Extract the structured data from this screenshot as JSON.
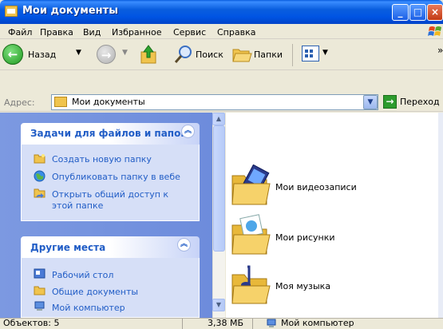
{
  "window": {
    "title": "Мои документы"
  },
  "menu": [
    "Файл",
    "Правка",
    "Вид",
    "Избранное",
    "Сервис",
    "Справка"
  ],
  "toolbar": {
    "back_label": "Назад",
    "search_label": "Поиск",
    "folders_label": "Папки"
  },
  "address": {
    "label": "Адрес:",
    "value": "Мои документы",
    "go_label": "Переход"
  },
  "tasks_panel": {
    "title": "Задачи для файлов и папок",
    "items": [
      {
        "label": "Создать новую папку",
        "icon": "new-folder-icon"
      },
      {
        "label": "Опубликовать папку в вебе",
        "icon": "web-publish-icon"
      },
      {
        "label_line1": "Открыть общий доступ к",
        "label_line2": "этой папке",
        "icon": "share-icon"
      }
    ]
  },
  "places_panel": {
    "title": "Другие места",
    "items": [
      {
        "label": "Рабочий стол",
        "icon": "desktop-icon"
      },
      {
        "label": "Общие документы",
        "icon": "shared-docs-icon"
      },
      {
        "label": "Мой компьютер",
        "icon": "my-computer-icon"
      }
    ]
  },
  "folders": [
    {
      "label": "Мои видеозаписи",
      "icon": "video-folder-icon"
    },
    {
      "label": "Мои рисунки",
      "icon": "pictures-folder-icon"
    },
    {
      "label": "Моя музыка",
      "icon": "music-folder-icon"
    }
  ],
  "status": {
    "objects": "Объектов: 5",
    "size": "3,38 МБ",
    "location": "Мой компьютер"
  },
  "colors": {
    "titlebar": "#0054e3",
    "task_link": "#215dc6",
    "task_pane": "#7c99e1"
  }
}
